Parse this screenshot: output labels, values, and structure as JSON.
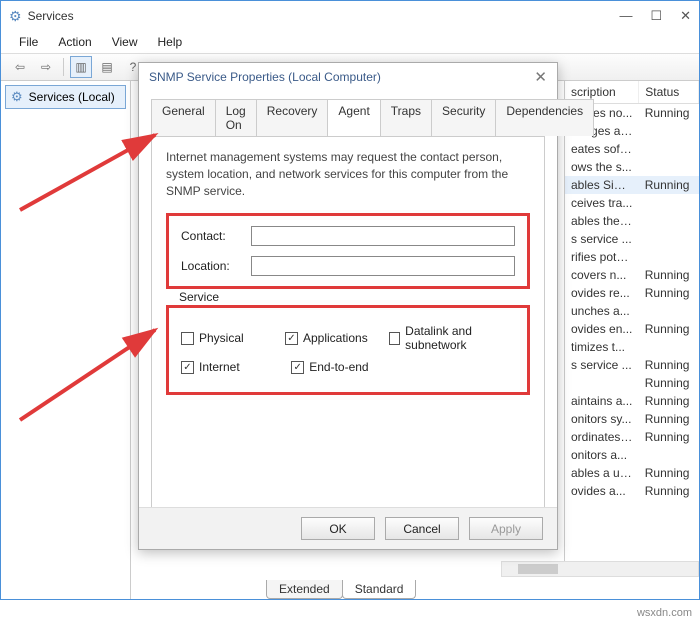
{
  "window": {
    "title": "Services"
  },
  "menu": {
    "file": "File",
    "action": "Action",
    "view": "View",
    "help": "Help"
  },
  "nav": {
    "root": "Services (Local)"
  },
  "dialog": {
    "title": "SNMP Service Properties (Local Computer)",
    "tabs": {
      "general": "General",
      "logon": "Log On",
      "recovery": "Recovery",
      "agent": "Agent",
      "traps": "Traps",
      "security": "Security",
      "dependencies": "Dependencies"
    },
    "desc": "Internet management systems may request the contact person, system location, and network services for this computer from the SNMP service.",
    "contact_label": "Contact:",
    "location_label": "Location:",
    "contact_value": "",
    "location_value": "",
    "service_legend": "Service",
    "cb": {
      "physical": "Physical",
      "applications": "Applications",
      "datalink": "Datalink and subnetwork",
      "internet": "Internet",
      "endtoend": "End-to-end"
    },
    "buttons": {
      "ok": "OK",
      "cancel": "Cancel",
      "apply": "Apply"
    }
  },
  "list": {
    "headers": {
      "desc": "scription",
      "status": "Status"
    },
    "rows": [
      {
        "d": "ovides no...",
        "s": "Running"
      },
      {
        "d": "anages ac...",
        "s": ""
      },
      {
        "d": "eates soft...",
        "s": ""
      },
      {
        "d": "ows the s...",
        "s": ""
      },
      {
        "d": "ables Sim...",
        "s": "Running",
        "sel": true
      },
      {
        "d": "ceives tra...",
        "s": ""
      },
      {
        "d": "ables the ...",
        "s": ""
      },
      {
        "d": "s service ...",
        "s": ""
      },
      {
        "d": "rifies pote...",
        "s": ""
      },
      {
        "d": "covers n...",
        "s": "Running"
      },
      {
        "d": "ovides re...",
        "s": "Running"
      },
      {
        "d": "unches a...",
        "s": ""
      },
      {
        "d": "ovides en...",
        "s": "Running"
      },
      {
        "d": "timizes t...",
        "s": ""
      },
      {
        "d": "s service ...",
        "s": "Running"
      },
      {
        "d": "",
        "s": "Running"
      },
      {
        "d": "aintains a...",
        "s": "Running"
      },
      {
        "d": "onitors sy...",
        "s": "Running"
      },
      {
        "d": "ordinates ...",
        "s": "Running"
      },
      {
        "d": "onitors a...",
        "s": ""
      },
      {
        "d": "ables a us...",
        "s": "Running"
      },
      {
        "d": "ovides a...",
        "s": "Running"
      }
    ]
  },
  "bottom_tabs": {
    "extended": "Extended",
    "standard": "Standard"
  },
  "watermark": "wsxdn.com"
}
